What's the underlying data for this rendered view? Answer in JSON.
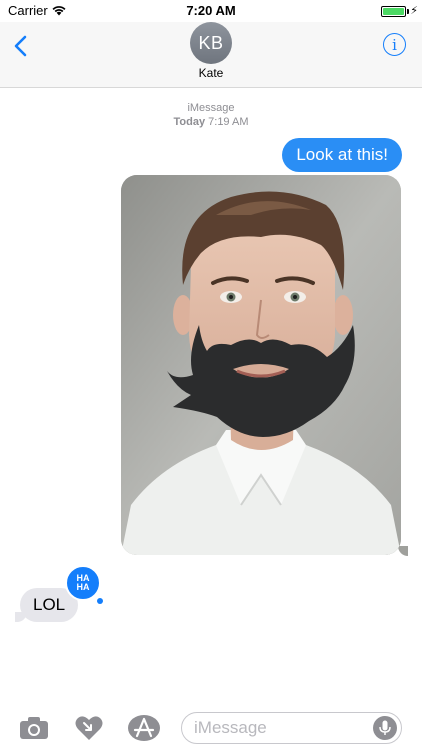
{
  "status_bar": {
    "carrier": "Carrier",
    "time": "7:20 AM",
    "battery_level": 1.0,
    "wifi_icon": "wifi-icon",
    "charging_icon": "bolt-icon"
  },
  "header": {
    "back_icon": "chevron-left-icon",
    "avatar_initials": "KB",
    "contact_name": "Kate",
    "info_label": "i",
    "accent_color": "#147efb"
  },
  "conversation": {
    "service_label": "iMessage",
    "day_label": "Today",
    "time_label": "7:19 AM",
    "messages": [
      {
        "direction": "outgoing",
        "type": "text",
        "text": "Look at this!"
      },
      {
        "direction": "outgoing",
        "type": "image",
        "image_icon": "photo-young-man-cartoon-beard-sticker"
      },
      {
        "direction": "incoming",
        "type": "text",
        "text": "LOL",
        "tapback_top": "HA",
        "tapback_bottom": "HA"
      }
    ],
    "outgoing_color": "#2a8ef5",
    "incoming_color": "#e6e6eb"
  },
  "input_bar": {
    "camera_icon": "camera-icon",
    "digital_touch_icon": "heart-touch-icon",
    "app_store_icon": "app-store-icon",
    "placeholder": "iMessage",
    "mic_icon": "microphone-icon"
  }
}
